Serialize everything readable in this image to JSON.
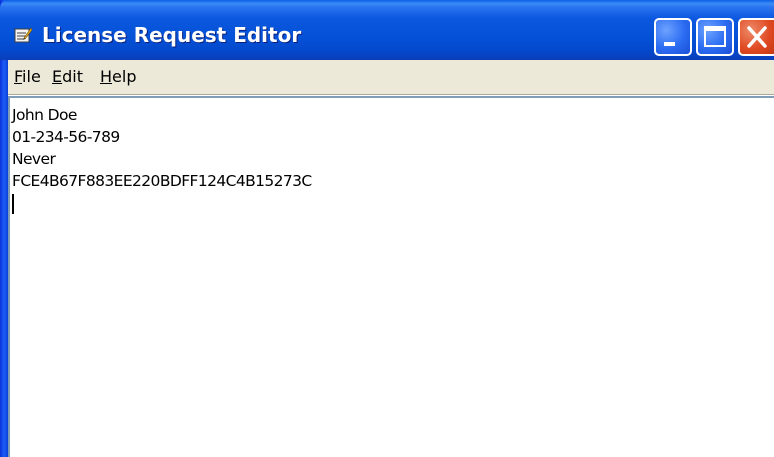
{
  "window": {
    "title": "License Request Editor",
    "title_color": "#ffffff",
    "titlebar_color": "#0452d8",
    "close_color": "#e04a22"
  },
  "menu": {
    "items": [
      {
        "accel": "F",
        "rest": "ile"
      },
      {
        "accel": "E",
        "rest": "dit"
      },
      {
        "accel": "H",
        "rest": "elp"
      }
    ]
  },
  "editor": {
    "lines": [
      "John Doe",
      "01-234-56-789",
      "Never",
      "FCE4B67F883EE220BDFF124C4B15273C"
    ]
  },
  "icons": {
    "app": "license-editor-icon",
    "minimize": "minimize-icon",
    "maximize": "maximize-icon",
    "close": "close-icon"
  }
}
